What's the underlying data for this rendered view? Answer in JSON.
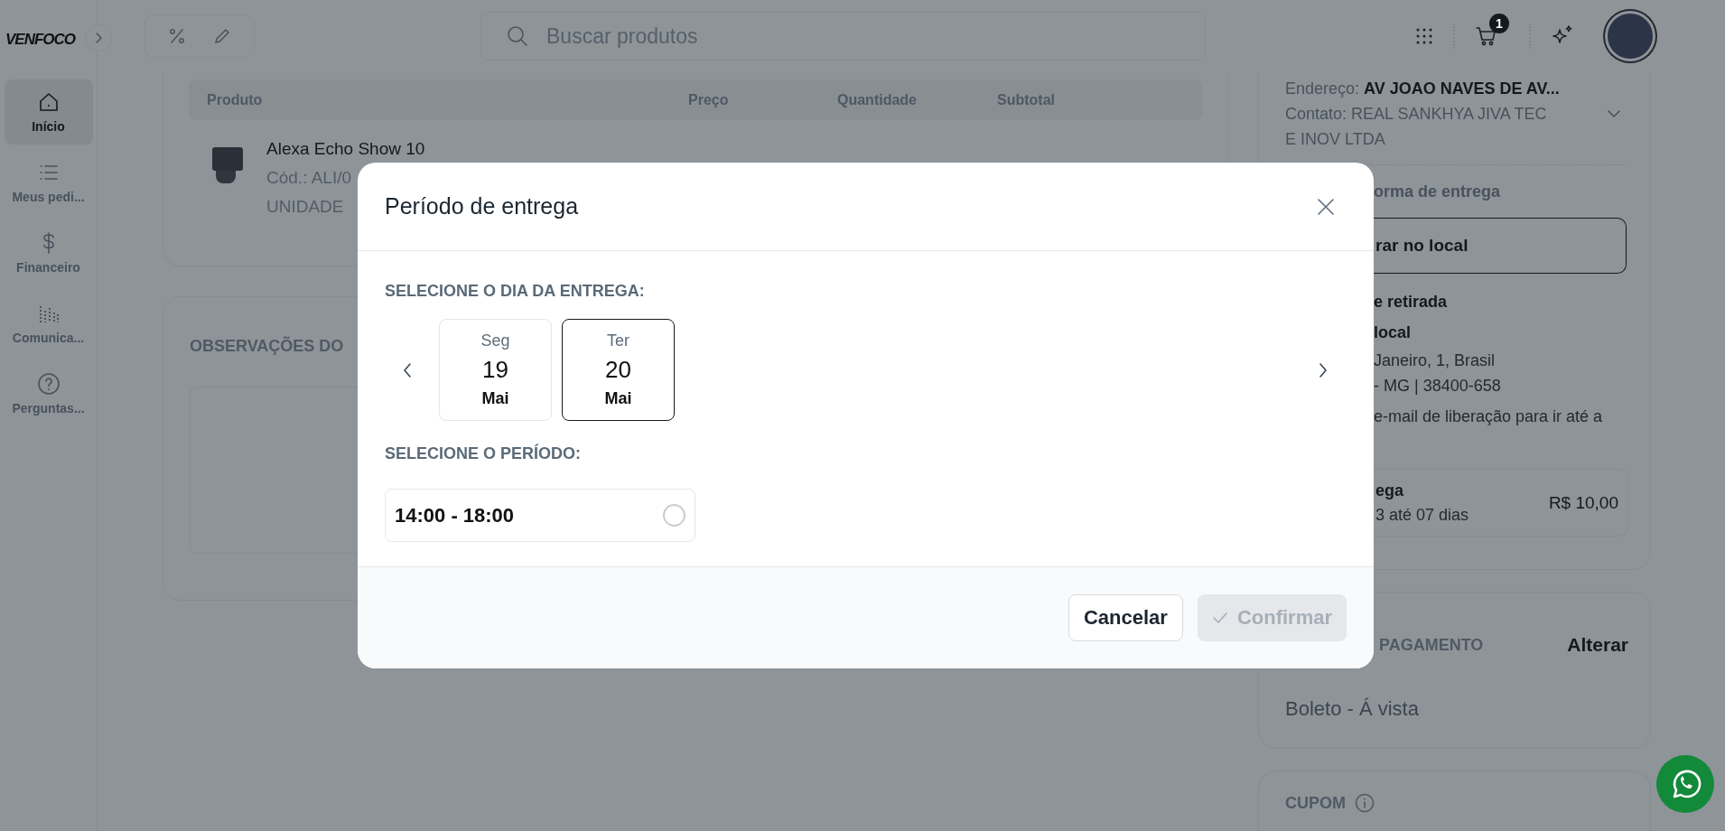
{
  "sidebar": {
    "logo": "VENFOCO",
    "items": [
      {
        "label": "Início",
        "selected": true
      },
      {
        "label": "Meus pedi...",
        "selected": false
      },
      {
        "label": "Financeiro",
        "selected": false
      },
      {
        "label": "Comunica...",
        "selected": false
      },
      {
        "label": "Perguntas...",
        "selected": false
      }
    ]
  },
  "topbar": {
    "search": {
      "placeholder": "Buscar produtos"
    },
    "cart_count": "1"
  },
  "order_table": {
    "columns": [
      "Produto",
      "Preço",
      "Quantidade",
      "Subtotal"
    ],
    "rows": [
      {
        "name": "Alexa Echo Show 10",
        "code": "Cód.: ALI/0",
        "unit": "UNIDADE"
      }
    ]
  },
  "notes": {
    "title": "OBSERVAÇÕES DO"
  },
  "delivery_panel": {
    "address": "Endereço: **AV JOAO NAVES DE AV...**",
    "contact": "Contato: REAL SANKHYA JIVA TEC E INOV LTDA",
    "method_label": "orma de entrega",
    "method_button": "rar no local",
    "pickup_title": "e retirada",
    "pickup_name": "local",
    "pickup_lines": [
      "Janeiro, 1, Brasil",
      "- MG | 38400-658"
    ],
    "notice": "e-mail de liberação para ir até a",
    "shipping": {
      "title": "ega",
      "time": "3 até 07 dias",
      "price": "R$ 10,00"
    }
  },
  "payment": {
    "title": "PAGAMENTO",
    "action": "Alterar",
    "value": "Boleto - Á vista"
  },
  "coupon": {
    "title": "CUPOM"
  },
  "delivery_modal": {
    "title": "Período de entrega",
    "day_label": "SELECIONE O DIA DA ENTREGA:",
    "days": [
      {
        "weekday": "Seg",
        "day": "19",
        "month": "Mai",
        "selected": false
      },
      {
        "weekday": "Ter",
        "day": "20",
        "month": "Mai",
        "selected": true
      }
    ],
    "period_label": "SELECIONE O PERÍODO:",
    "periods": [
      {
        "label": "14:00 - 18:00",
        "selected": false
      }
    ],
    "buttons": [
      {
        "label": "Cancelar",
        "kind": "secondary",
        "disabled": false
      },
      {
        "label": "Confirmar",
        "kind": "primary",
        "disabled": true
      }
    ]
  }
}
